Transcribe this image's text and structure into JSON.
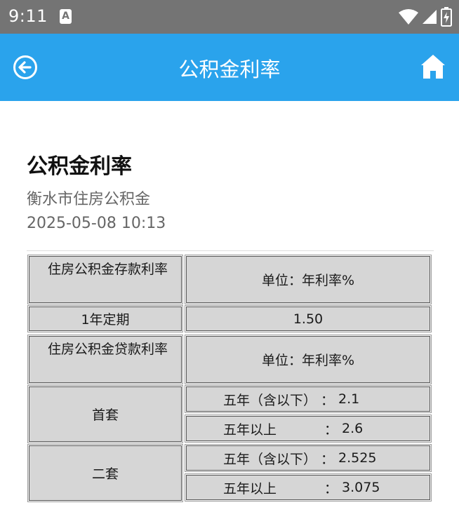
{
  "status_bar": {
    "time": "9:11",
    "notification_glyph": "A",
    "icons": [
      "wifi-icon",
      "signal-icon",
      "battery-icon"
    ]
  },
  "app_bar": {
    "title": "公积金利率",
    "back_icon": "back-arrow-icon",
    "home_icon": "home-icon",
    "color": "#2aa3ec"
  },
  "article": {
    "title": "公积金利率",
    "source": "衡水市住房公积金",
    "date": "2025-05-08 10:13"
  },
  "table": {
    "deposit_header": "住房公积金存款利率",
    "deposit_unit": "单位：年利率%",
    "deposit_term": "1年定期",
    "deposit_rate": "1.50",
    "loan_header": "住房公积金贷款利率",
    "loan_unit": "单位：年利率%",
    "first_home": {
      "label": "首套",
      "rows": [
        {
          "term": "五年（含以下）",
          "sep": "：",
          "rate": "2.1"
        },
        {
          "term": "五年以上",
          "sep": "：",
          "rate": "2.6"
        }
      ]
    },
    "second_home": {
      "label": "二套",
      "rows": [
        {
          "term": "五年（含以下）",
          "sep": "：",
          "rate": "2.525"
        },
        {
          "term": "五年以上",
          "sep": "：",
          "rate": "3.075"
        }
      ]
    }
  }
}
